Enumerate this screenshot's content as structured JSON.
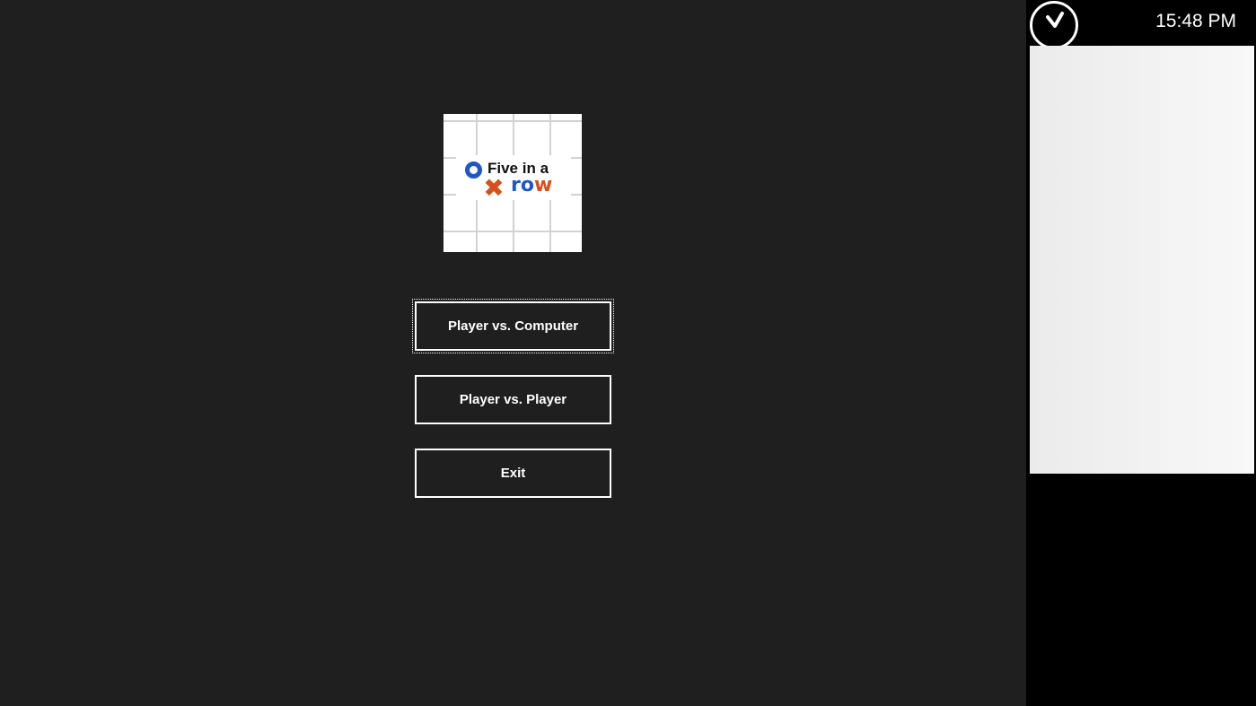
{
  "logo": {
    "line1": "Five in a",
    "line2_blue": "ro",
    "line2_orange": "w",
    "colors": {
      "o": "#1d57c8",
      "x": "#d5501b"
    }
  },
  "menu": {
    "player_vs_computer": "Player vs. Computer",
    "player_vs_player": "Player vs. Player",
    "exit": "Exit"
  },
  "side": {
    "clock_icon": "clock-icon",
    "time": "15:48 PM"
  }
}
